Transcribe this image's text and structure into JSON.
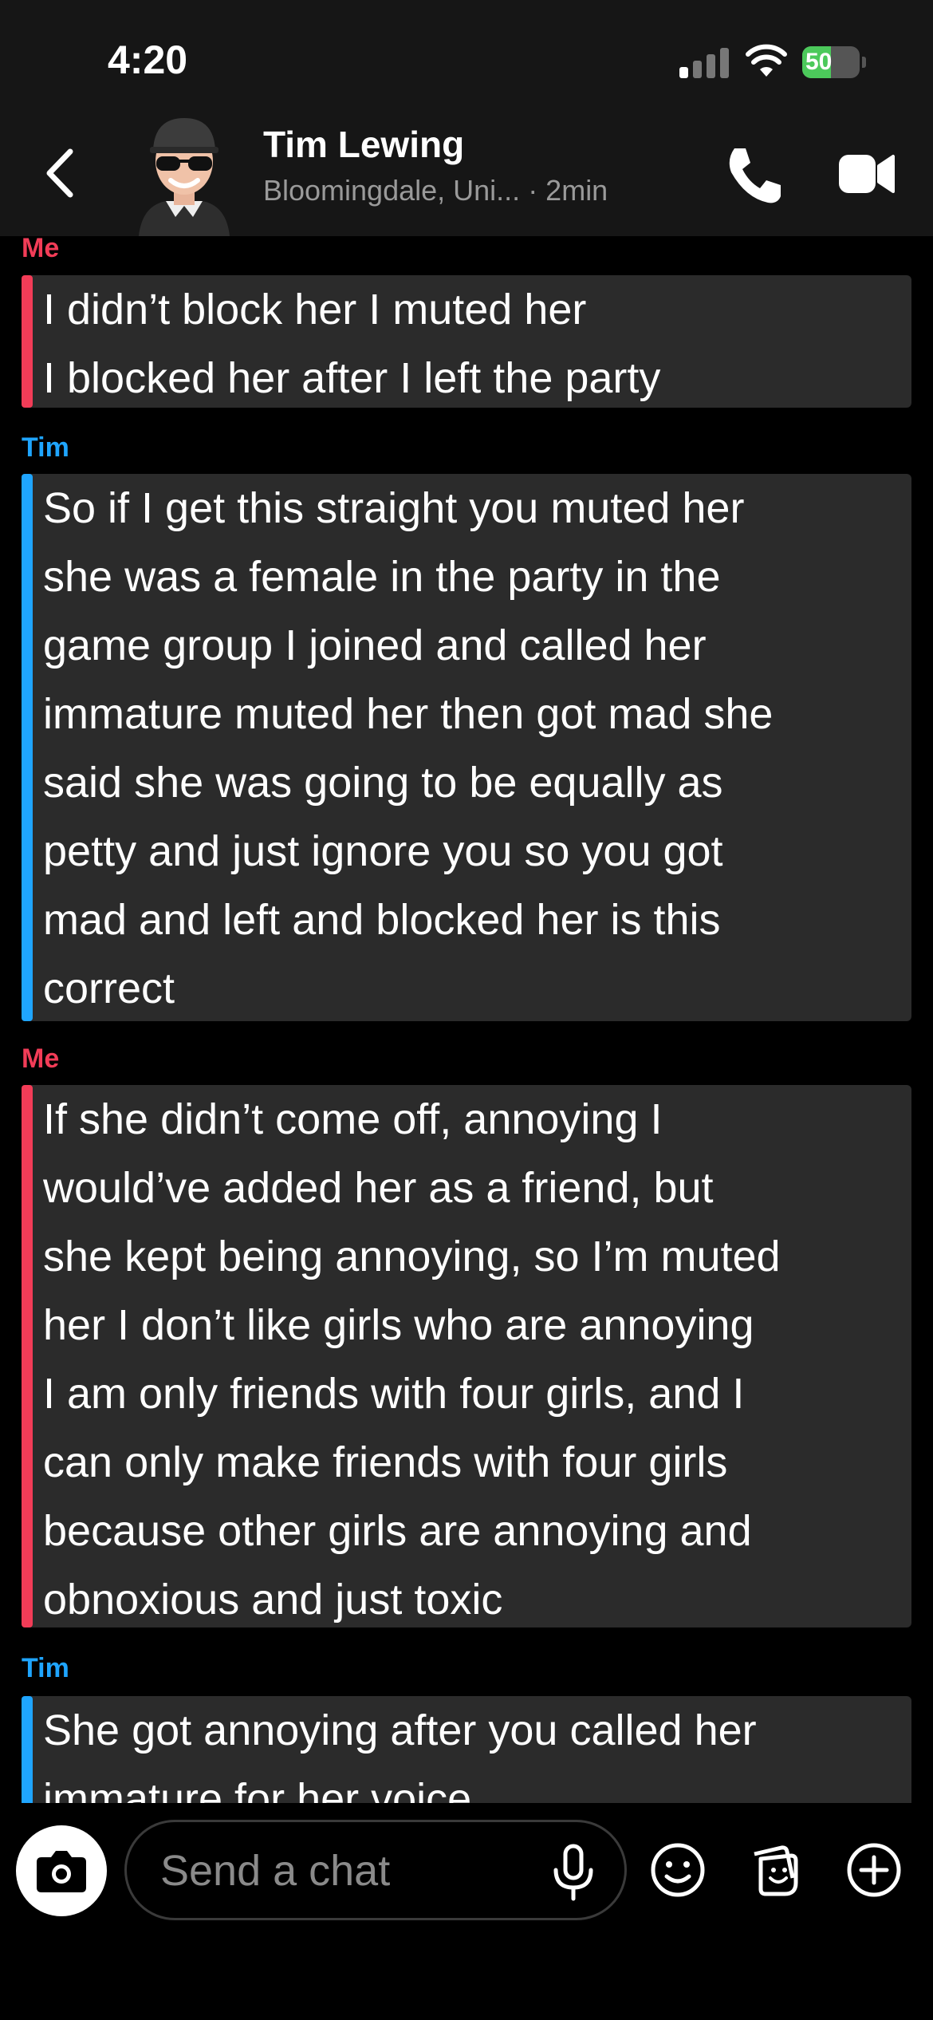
{
  "status_bar": {
    "time": "4:20",
    "battery": "50",
    "battery_level": 0.5
  },
  "header": {
    "contact_name": "Tim Lewing",
    "location": "Bloomingdale, Uni...",
    "last_seen": "· 2min"
  },
  "messages": [
    {
      "sender": "Me",
      "lines": [
        "I didn’t block her I muted her",
        "I blocked her after I left the party"
      ]
    },
    {
      "sender": "Tim",
      "lines": [
        "So if I get this straight you muted her",
        "she was a female in the party in the",
        "game group I joined and called her",
        "immature muted her then got mad she",
        "said she was going to be equally as",
        "petty and just ignore you so you got",
        "mad and left and blocked her is this",
        "correct"
      ]
    },
    {
      "sender": "Me",
      "lines": [
        "If she didn’t come off, annoying I",
        "would’ve added her as a friend, but",
        "she kept being annoying, so I’m muted",
        "her I don’t like girls who are annoying",
        "I am only friends with four girls, and I",
        "can only make friends with four girls",
        "because other girls are annoying and",
        "obnoxious and just toxic"
      ]
    },
    {
      "sender": "Tim",
      "lines": [
        "She got annoying after you called her",
        "immature for her voice"
      ]
    }
  ],
  "composer": {
    "placeholder": "Send a chat"
  },
  "colors": {
    "me": "#f23c57",
    "tim": "#1fa5ff",
    "bubble": "#2b2b2b",
    "battery": "#4cc95b"
  },
  "icons": [
    "back-icon",
    "phone-icon",
    "video-icon",
    "camera-icon",
    "microphone-icon",
    "emoji-icon",
    "sticker-icon",
    "plus-icon"
  ]
}
